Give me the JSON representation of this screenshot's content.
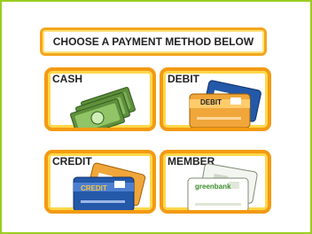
{
  "header": {
    "title": "CHOOSE A PAYMENT METHOD BELOW"
  },
  "options": {
    "cash": {
      "label": "CASH",
      "icon": "cash-bills-icon"
    },
    "debit": {
      "label": "DEBIT",
      "icon": "debit-card-icon",
      "card_text": "DEBIT"
    },
    "credit": {
      "label": "CREDIT",
      "icon": "credit-card-icon",
      "card_text": "CREDIT"
    },
    "member": {
      "label": "MEMBER",
      "icon": "member-card-icon",
      "card_text": "greenbank"
    }
  },
  "colors": {
    "frame_border": "#9acd1f",
    "tile_border": "#f39a12",
    "tile_glow": "#ffd84a",
    "card_blue": "#2458a8",
    "card_orange": "#f0a63a",
    "bill_green": "#5f8f3b"
  }
}
